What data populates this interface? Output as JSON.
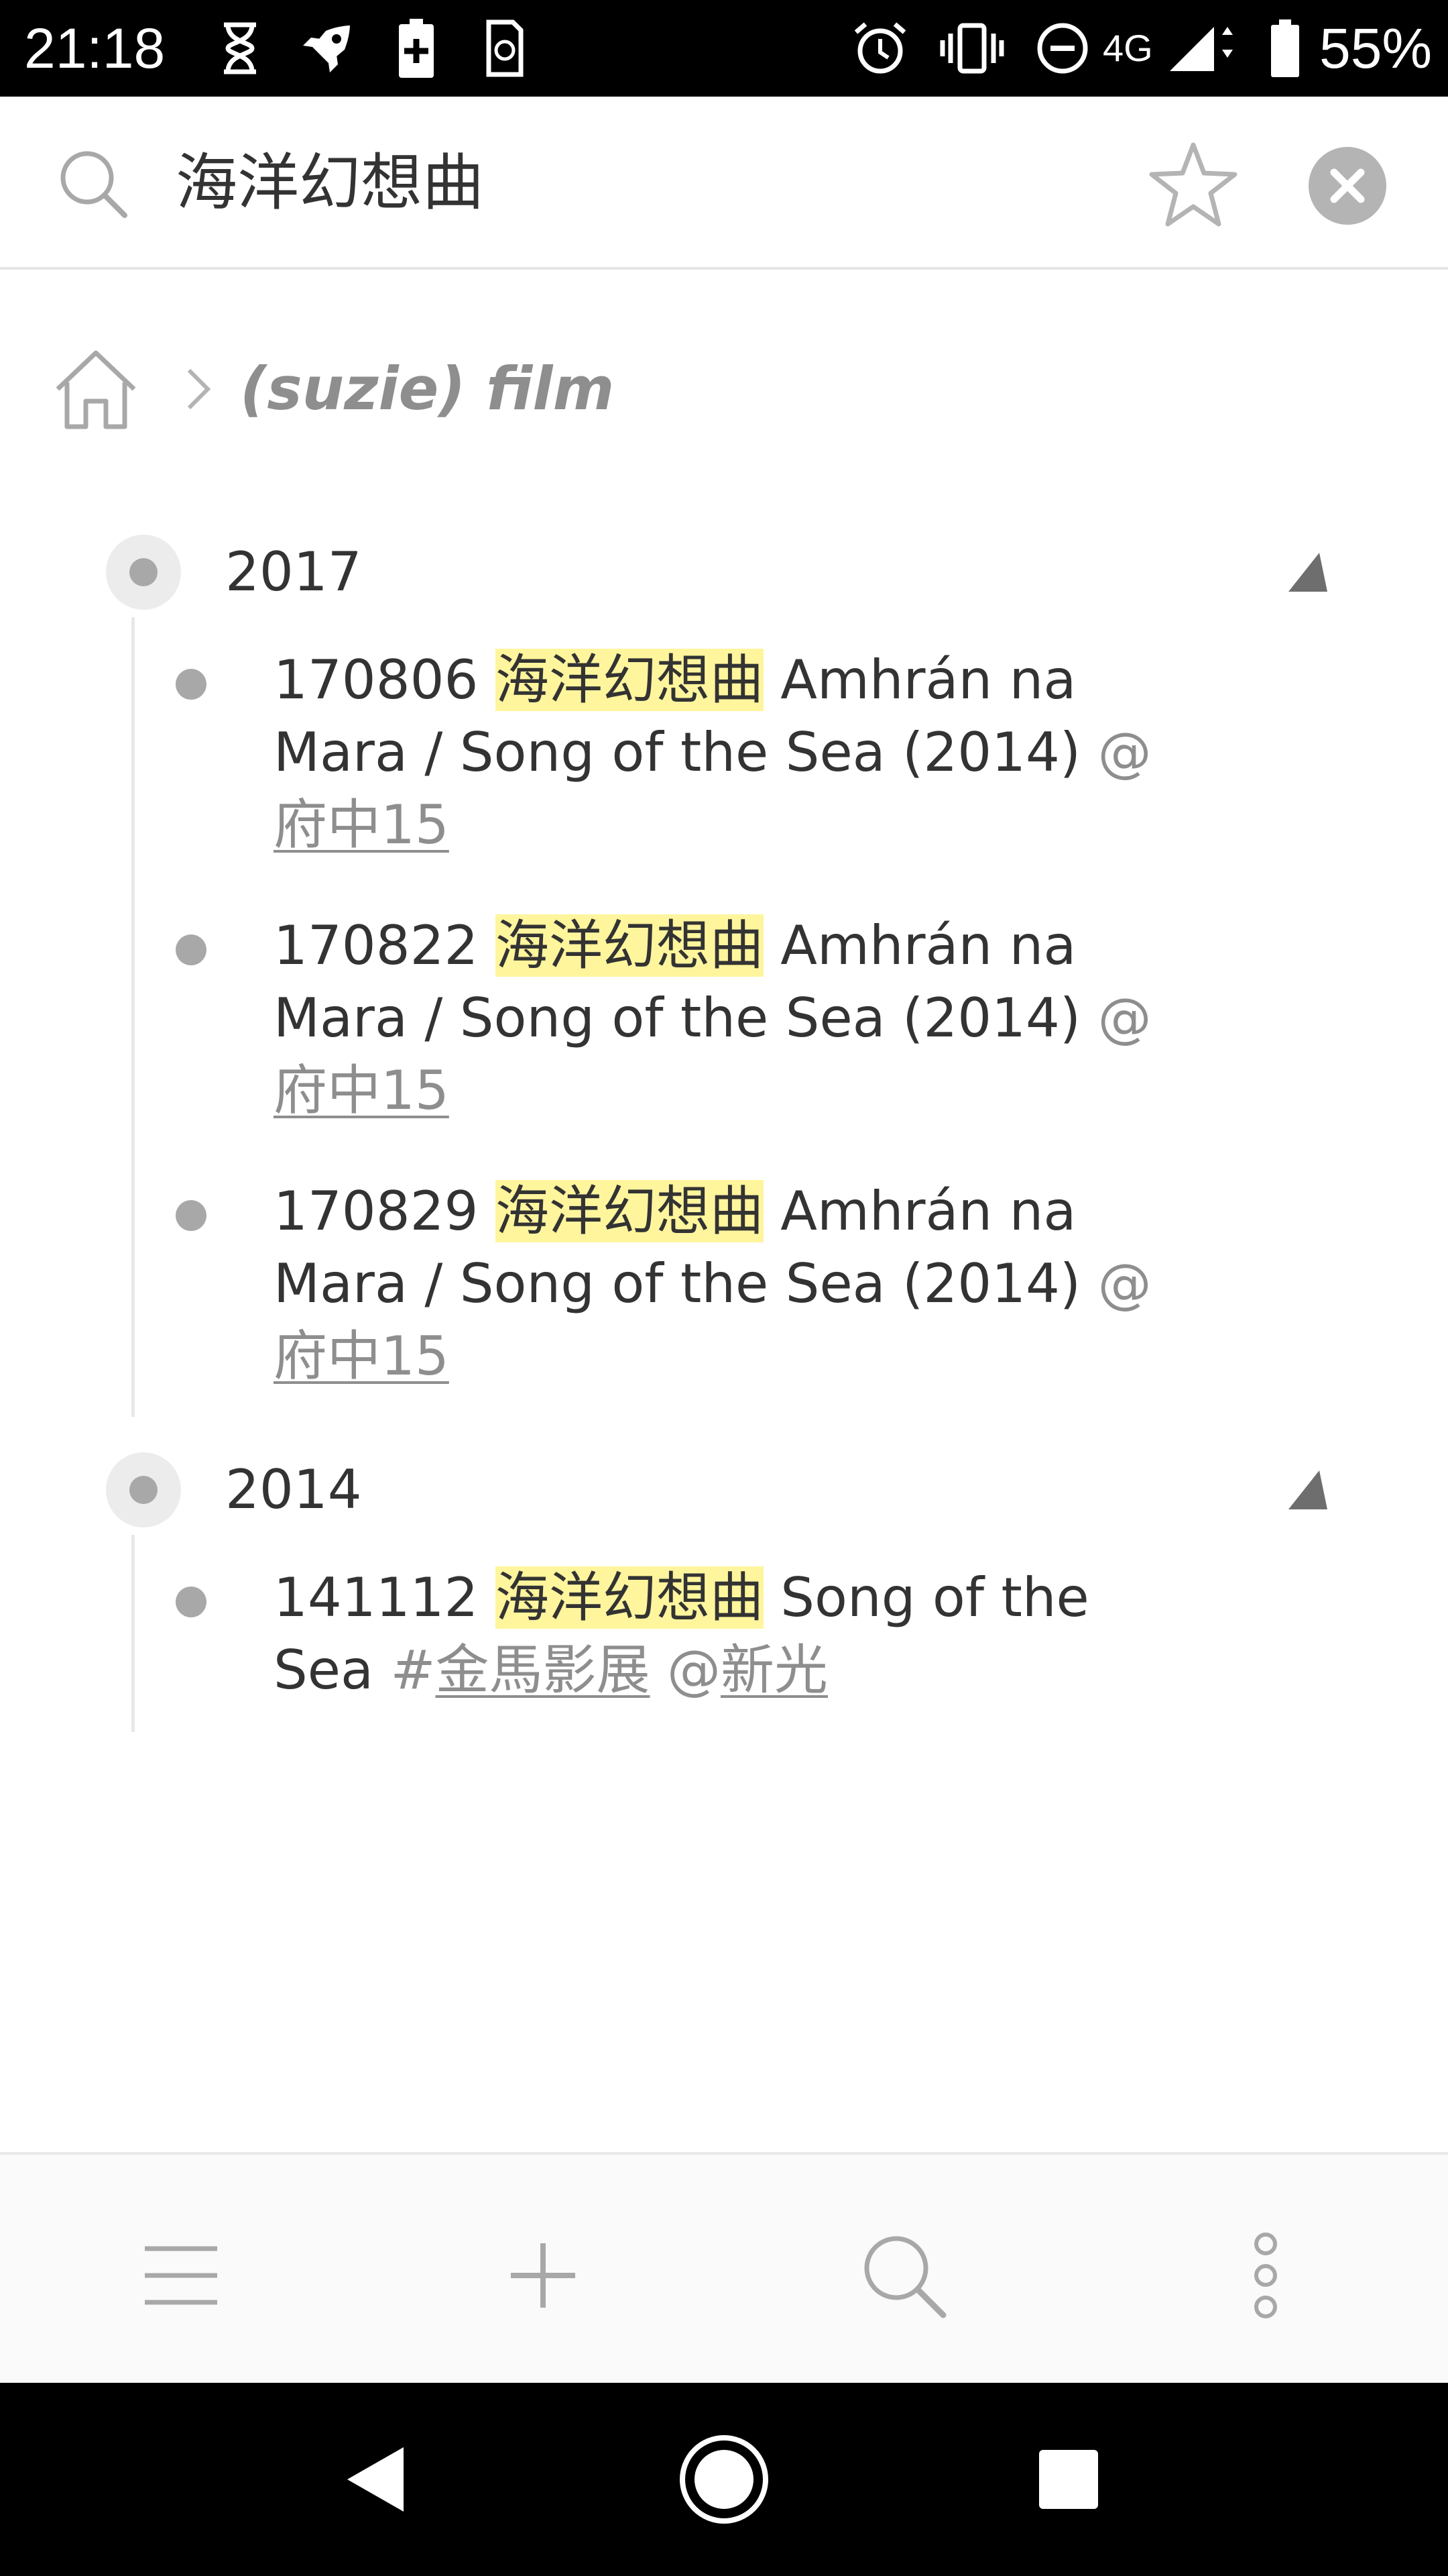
{
  "status_bar": {
    "time": "21:18",
    "network": "4G",
    "battery": "55%",
    "icons": [
      "hourglass-icon",
      "rocket-icon",
      "battery-saver-icon",
      "sim-icon",
      "alarm-icon",
      "vibrate-icon",
      "do-not-disturb-icon",
      "signal-icon",
      "battery-icon"
    ]
  },
  "search": {
    "query": "海洋幻想曲"
  },
  "breadcrumb": {
    "title": "(suzie) film"
  },
  "outline": {
    "groups": [
      {
        "label": "2017",
        "items": [
          {
            "date": "170806",
            "highlight": "海洋幻想曲",
            "text": "Amhrán na Mara / Song of the Sea (2014)",
            "at": "@",
            "place": "府中15"
          },
          {
            "date": "170822",
            "highlight": "海洋幻想曲",
            "text": "Amhrán na Mara / Song of the Sea (2014)",
            "at": "@",
            "place": "府中15"
          },
          {
            "date": "170829",
            "highlight": "海洋幻想曲",
            "text": "Amhrán na Mara / Song of the Sea (2014)",
            "at": "@",
            "place": "府中15"
          }
        ]
      },
      {
        "label": "2014",
        "items": [
          {
            "date": "141112",
            "highlight": "海洋幻想曲",
            "text": "Song of the Sea",
            "hash": "#",
            "tag": "金馬影展",
            "at": "@",
            "place": "新光"
          }
        ]
      }
    ]
  },
  "toolbar": {
    "buttons": [
      "menu-icon",
      "plus-icon",
      "search-icon",
      "more-vertical-icon"
    ]
  },
  "nav": {
    "buttons": [
      "back-icon",
      "home-icon",
      "recents-icon"
    ]
  },
  "colors": {
    "highlight": "#fff59d",
    "muted": "#8e8e8e",
    "text": "#333333"
  }
}
